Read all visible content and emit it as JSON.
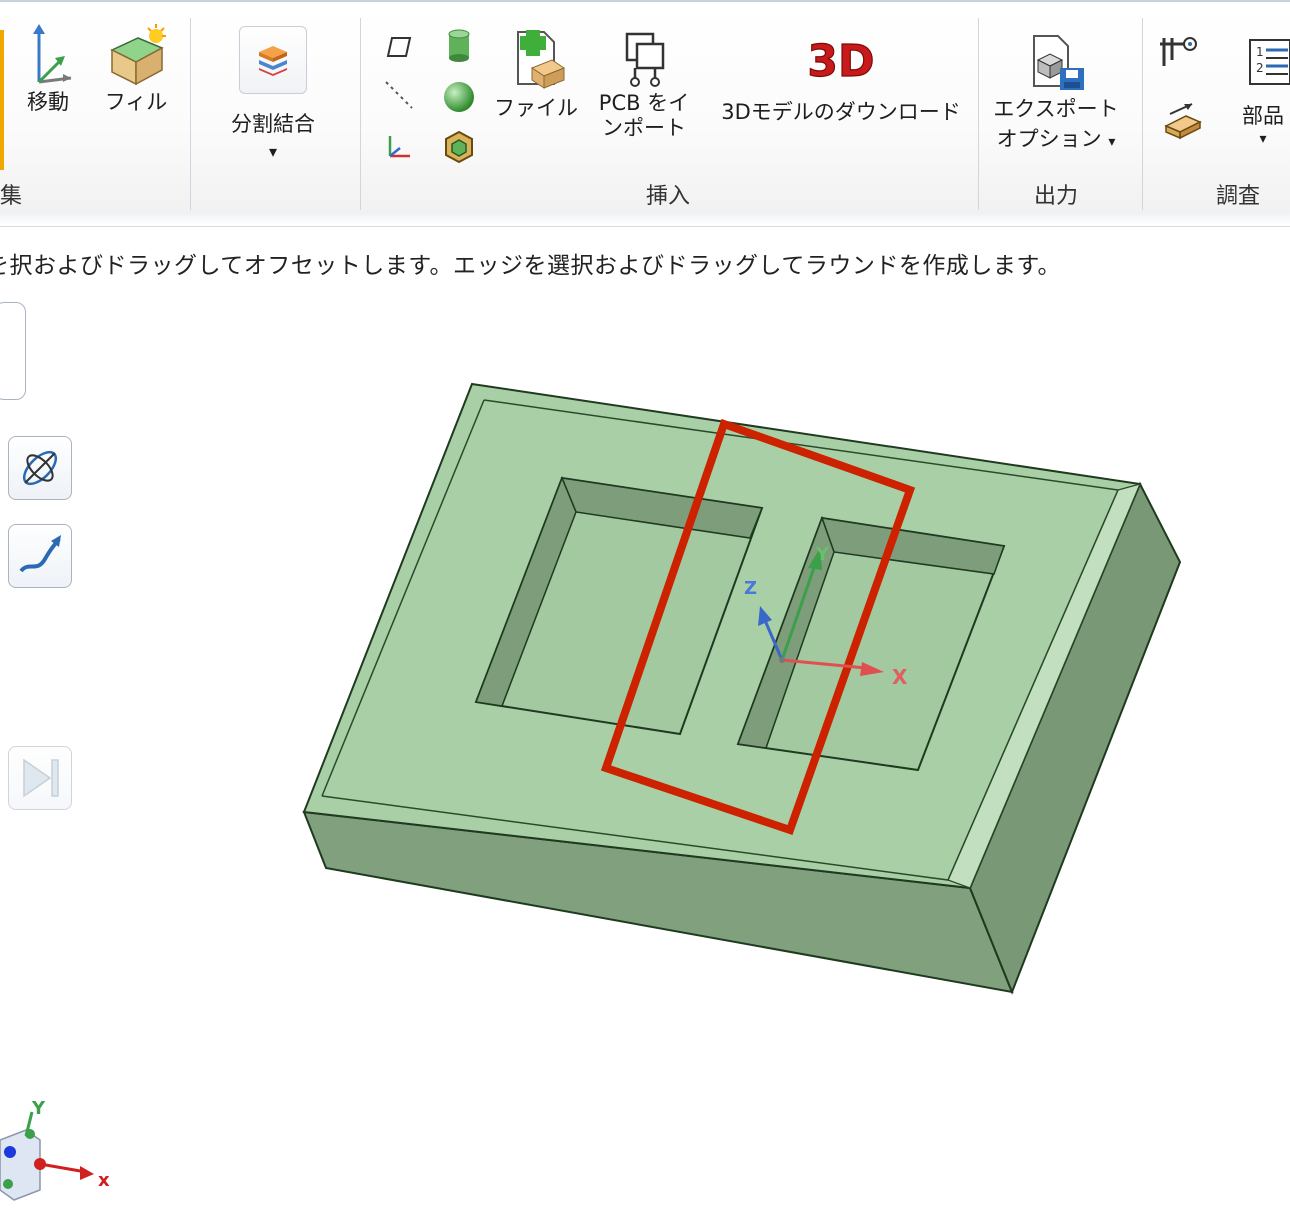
{
  "ribbon": {
    "groups": {
      "edit": {
        "label": "編集"
      },
      "split": {
        "label": ""
      },
      "insert": {
        "label": "挿入"
      },
      "output": {
        "label": "出力"
      },
      "inspect": {
        "label": "調査"
      }
    },
    "buttons": {
      "move": "移動",
      "fill": "フィル",
      "split_combine": "分割結合",
      "file": "ファイル",
      "pcb_import_line1": "PCB をイ",
      "pcb_import_line2": "ンポート",
      "download_3d": "3Dモデルのダウンロード",
      "export_options_line1": "エクスポート",
      "export_options_line2": "オプション",
      "parts": "部品"
    },
    "dropdown_glyph": "▾"
  },
  "status": {
    "hint": "を択およびドラッグしてオフセットします。エッジを選択およびドラッグしてラウンドを作成します。"
  },
  "viewport": {
    "triad_labels": {
      "x": "X",
      "y": "Y",
      "z": "Z"
    },
    "mini_triad_labels": {
      "x": "x",
      "y": "Y"
    },
    "model_color": "#a9cfa7",
    "model_side_color": "#7f9f7d",
    "highlight_color": "#cc2200"
  },
  "icons": [
    "move-icon",
    "fill-icon",
    "split-combine-icon",
    "sketch-plane-icon",
    "cylinder-icon",
    "line-icon",
    "sphere-icon",
    "axis-icon",
    "component-icon",
    "file-insert-icon",
    "pcb-import-icon",
    "3d-logo-icon",
    "export-options-icon",
    "caliper-icon",
    "list-icon",
    "measure-icon",
    "spin-icon",
    "sweep-icon",
    "next-step-icon"
  ]
}
